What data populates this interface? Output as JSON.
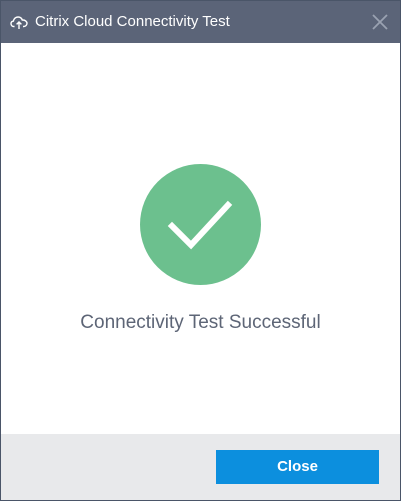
{
  "window": {
    "title": "Citrix Cloud Connectivity Test",
    "title_icon": "cloud-upload-icon",
    "close_icon": "close-icon"
  },
  "content": {
    "status_icon": "checkmark-icon",
    "status_text": "Connectivity Test Successful"
  },
  "footer": {
    "close_label": "Close"
  },
  "colors": {
    "titlebar": "#5b6478",
    "success_green": "#6cc08e",
    "primary_button": "#0c8fde",
    "footer_bg": "#e8e9eb",
    "status_text": "#5d6576"
  }
}
